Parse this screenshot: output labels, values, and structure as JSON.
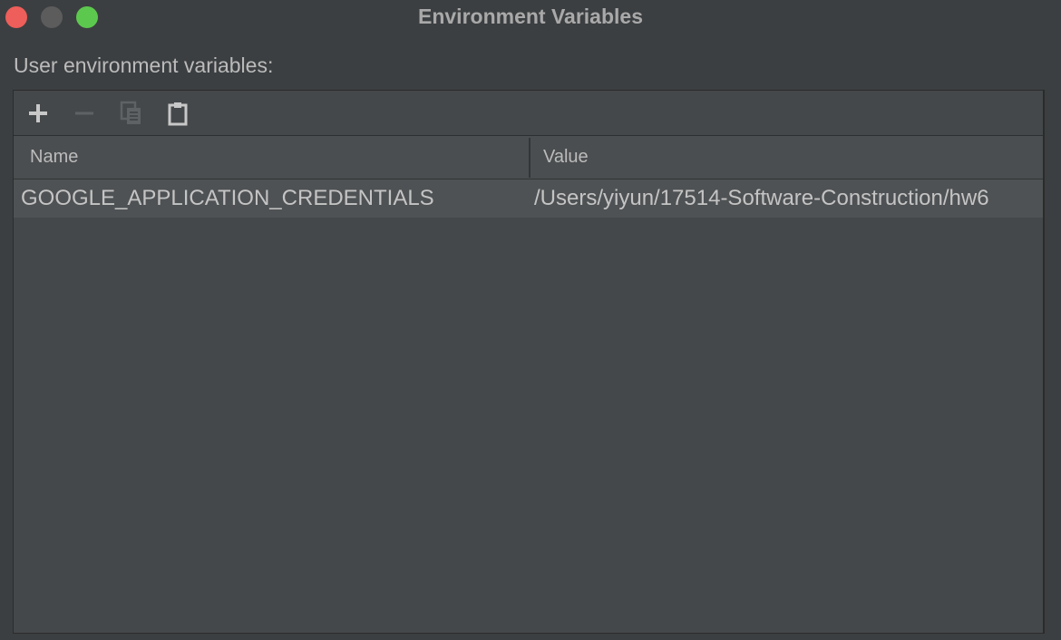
{
  "window": {
    "title": "Environment Variables"
  },
  "section_label": "User environment variables:",
  "toolbar": {
    "buttons": [
      {
        "icon": "plus-icon",
        "enabled": true
      },
      {
        "icon": "minus-icon",
        "enabled": false
      },
      {
        "icon": "copy-icon",
        "enabled": false
      },
      {
        "icon": "paste-icon",
        "enabled": true
      }
    ]
  },
  "table": {
    "columns": [
      "Name",
      "Value"
    ],
    "rows": [
      {
        "name": "GOOGLE_APPLICATION_CREDENTIALS",
        "value": "/Users/yiyun/17514-Software-Construction/hw6"
      }
    ]
  },
  "colors": {
    "background": "#3c3f41",
    "panel": "#45484a",
    "header": "#4b4e50",
    "row": "#4f5254",
    "close": "#ee5e5a",
    "minimize": "#5c5c5c",
    "zoom": "#5cc94e"
  }
}
